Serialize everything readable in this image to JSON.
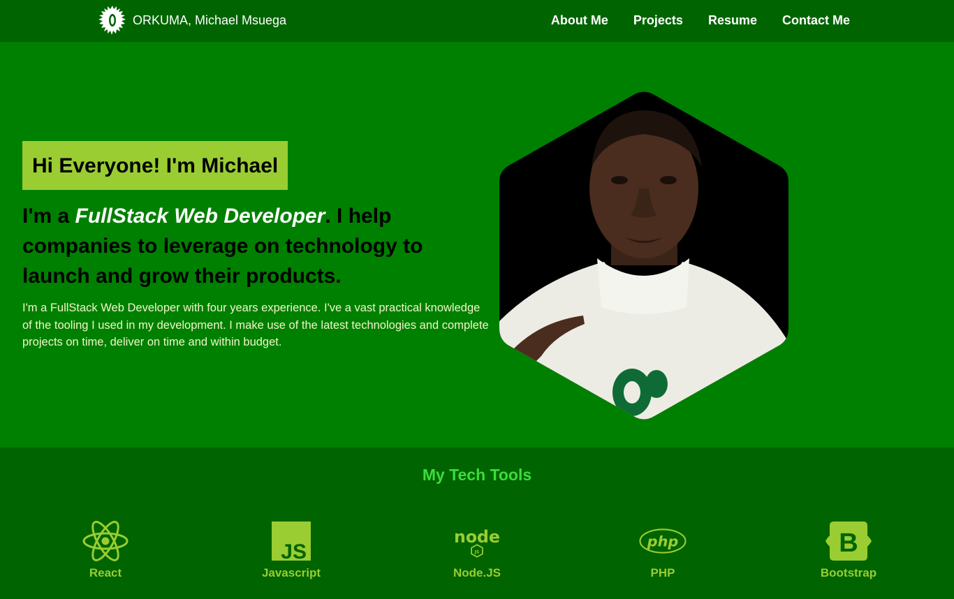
{
  "navbar": {
    "brand": "ORKUMA, Michael Msuega",
    "links": [
      "About Me",
      "Projects",
      "Resume",
      "Contact Me"
    ]
  },
  "hero": {
    "greeting": "Hi Everyone! I'm Michael",
    "headline_prefix": "I'm a ",
    "headline_role": "FullStack Web Developer",
    "headline_suffix": ". I help companies to leverage on technology to launch and grow their products.",
    "bio": "I'm a FullStack Web Developer with four years experience. I've a vast practical knowledge of the tooling I used in my development. I make use of the latest technologies and complete projects on time, deliver on time and within budget."
  },
  "tools": {
    "title": "My Tech Tools",
    "items": [
      {
        "label": "React",
        "icon": "react-icon"
      },
      {
        "label": "Javascript",
        "icon": "javascript-icon"
      },
      {
        "label": "Node.JS",
        "icon": "nodejs-icon"
      },
      {
        "label": "PHP",
        "icon": "php-icon"
      },
      {
        "label": "Bootstrap",
        "icon": "bootstrap-icon"
      }
    ]
  },
  "colors": {
    "navbar": "#006400",
    "hero": "#008000",
    "accent": "#9acd32",
    "tools_title": "#3cdc3c"
  }
}
